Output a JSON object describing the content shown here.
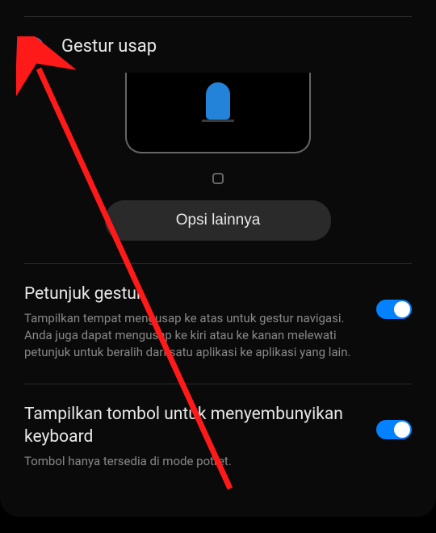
{
  "gesture": {
    "radio_label": "Gestur usap",
    "options_button": "Opsi lainnya"
  },
  "settings": {
    "gesture_hints": {
      "title": "Petunjuk gestur",
      "description": "Tampilkan tempat mengusap ke atas untuk gestur navigasi. Anda juga dapat mengusap ke kiri atau ke kanan melewati petunjuk untuk beralih dari satu aplikasi ke aplikasi yang lain."
    },
    "keyboard_button": {
      "title": "Tampilkan tombol untuk menyembunyikan keyboard",
      "description": "Tombol hanya tersedia di mode potret."
    }
  }
}
